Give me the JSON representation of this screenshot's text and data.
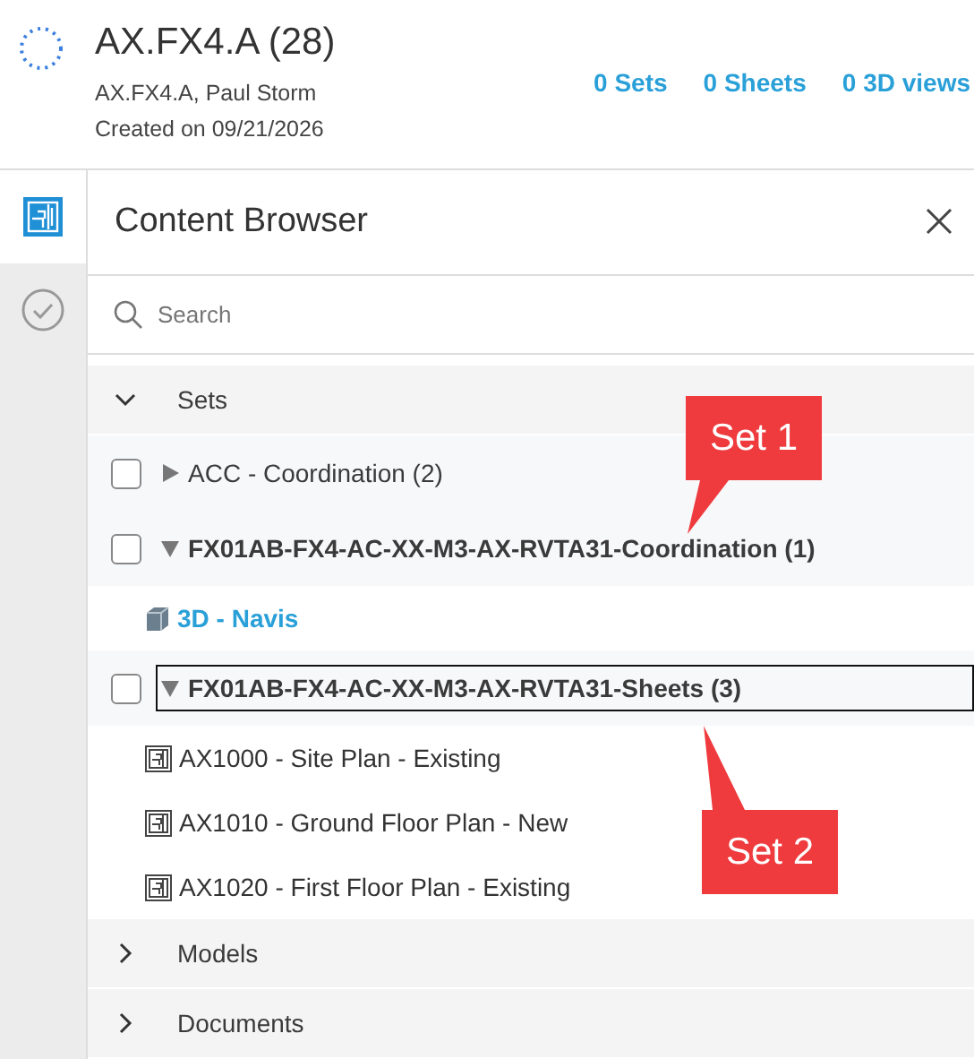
{
  "header": {
    "title": "AX.FX4.A (28)",
    "subtitle": "AX.FX4.A, Paul Storm",
    "created": "Created on 09/21/2026",
    "stats": [
      "0 Sets",
      "0 Sheets",
      "0 3D views"
    ]
  },
  "rail": [
    {
      "kind": "sheets",
      "selected": true
    },
    {
      "kind": "check",
      "selected": false
    }
  ],
  "panel": {
    "title": "Content Browser",
    "search": {
      "placeholder": "Search"
    },
    "sections": [
      {
        "label": "Sets",
        "expanded": true,
        "sets": [
          {
            "label": "ACC - Coordination (2)",
            "checked": false,
            "expanded": false,
            "focused": false
          },
          {
            "label": "FX01AB-FX4-AC-XX-M3-AX-RVTA31-Coordination (1)",
            "checked": false,
            "expanded": true,
            "focused": false,
            "children": [
              {
                "kind": "model",
                "label": "3D - Navis",
                "selected": true
              }
            ]
          },
          {
            "label": "FX01AB-FX4-AC-XX-M3-AX-RVTA31-Sheets (3)",
            "checked": false,
            "expanded": true,
            "focused": true,
            "children": [
              {
                "kind": "sheet",
                "label": "AX1000 - Site Plan - Existing",
                "selected": false
              },
              {
                "kind": "sheet",
                "label": "AX1010 - Ground Floor Plan - New",
                "selected": false
              },
              {
                "kind": "sheet",
                "label": "AX1020 - First Floor Plan - Existing",
                "selected": false
              }
            ]
          }
        ]
      },
      {
        "label": "Models",
        "expanded": false
      },
      {
        "label": "Documents",
        "expanded": false
      }
    ]
  },
  "callouts": [
    {
      "text": "Set 1",
      "kind": "down"
    },
    {
      "text": "Set 2",
      "kind": "up"
    }
  ]
}
